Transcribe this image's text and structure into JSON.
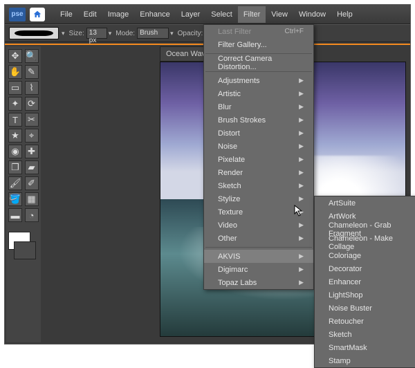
{
  "app": {
    "logo_text": "pse"
  },
  "menubar": [
    "File",
    "Edit",
    "Image",
    "Enhance",
    "Layer",
    "Select",
    "Filter",
    "View",
    "Window",
    "Help"
  ],
  "active_menu_index": 6,
  "options_bar": {
    "size_label": "Size:",
    "size_value": "13 px",
    "mode_label": "Mode:",
    "mode_value": "Brush",
    "opacity_label": "Opacity:"
  },
  "document_tab": "Ocean Wave",
  "tools": [
    {
      "name": "move-tool",
      "glyph": "✥"
    },
    {
      "name": "zoom-tool",
      "glyph": "🔍"
    },
    {
      "name": "hand-tool",
      "glyph": "✋"
    },
    {
      "name": "eyedropper-tool",
      "glyph": "✎"
    },
    {
      "name": "marquee-tool",
      "glyph": "▭"
    },
    {
      "name": "lasso-tool",
      "glyph": "⌇"
    },
    {
      "name": "wand-tool",
      "glyph": "✦"
    },
    {
      "name": "quicksel-tool",
      "glyph": "⟳"
    },
    {
      "name": "type-tool",
      "glyph": "T"
    },
    {
      "name": "crop-tool",
      "glyph": "✂"
    },
    {
      "name": "cookie-tool",
      "glyph": "★"
    },
    {
      "name": "straighten-tool",
      "glyph": "⌖"
    },
    {
      "name": "redeye-tool",
      "glyph": "◉"
    },
    {
      "name": "healing-tool",
      "glyph": "✚"
    },
    {
      "name": "clone-tool",
      "glyph": "❐"
    },
    {
      "name": "eraser-tool",
      "glyph": "▰"
    },
    {
      "name": "brush-tool",
      "glyph": "🖌"
    },
    {
      "name": "smartbrush-tool",
      "glyph": "✐"
    },
    {
      "name": "bucket-tool",
      "glyph": "🪣"
    },
    {
      "name": "gradient-tool",
      "glyph": "▦"
    },
    {
      "name": "shape-tool",
      "glyph": "▬"
    },
    {
      "name": "sponge-tool",
      "glyph": "◔"
    }
  ],
  "filter_menu": {
    "sections": [
      [
        {
          "label": "Last Filter",
          "shortcut": "Ctrl+F",
          "disabled": true
        },
        {
          "label": "Filter Gallery...",
          "submenu": false
        }
      ],
      [
        {
          "label": "Correct Camera Distortion...",
          "submenu": false
        }
      ],
      [
        {
          "label": "Adjustments",
          "submenu": true
        },
        {
          "label": "Artistic",
          "submenu": true
        },
        {
          "label": "Blur",
          "submenu": true
        },
        {
          "label": "Brush Strokes",
          "submenu": true
        },
        {
          "label": "Distort",
          "submenu": true
        },
        {
          "label": "Noise",
          "submenu": true
        },
        {
          "label": "Pixelate",
          "submenu": true
        },
        {
          "label": "Render",
          "submenu": true
        },
        {
          "label": "Sketch",
          "submenu": true
        },
        {
          "label": "Stylize",
          "submenu": true
        },
        {
          "label": "Texture",
          "submenu": true
        },
        {
          "label": "Video",
          "submenu": true
        },
        {
          "label": "Other",
          "submenu": true
        }
      ],
      [
        {
          "label": "AKVIS",
          "submenu": true,
          "hover": true
        },
        {
          "label": "Digimarc",
          "submenu": true
        },
        {
          "label": "Topaz Labs",
          "submenu": true
        }
      ]
    ]
  },
  "akvis_submenu": [
    "ArtSuite",
    "ArtWork",
    "Chameleon - Grab Fragment",
    "Chameleon - Make Collage",
    "Coloriage",
    "Decorator",
    "Enhancer",
    "LightShop",
    "Noise Buster",
    "Retoucher",
    "Sketch",
    "SmartMask",
    "Stamp"
  ]
}
